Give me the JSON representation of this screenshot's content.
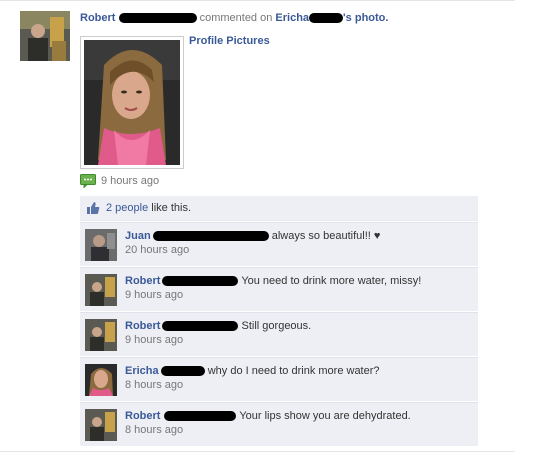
{
  "story": {
    "actor_name": "Robert",
    "action_text": "commented on",
    "photo_owner_first": "Ericha",
    "photo_suffix": "'s",
    "photo_word": "photo.",
    "album_title": "Profile Pictures",
    "timestamp": "9 hours ago"
  },
  "likes": {
    "count_text": "2 people",
    "suffix": "like this."
  },
  "comments": [
    {
      "author": "Juan",
      "text": "always so beautiful!! ♥",
      "time": "20 hours ago"
    },
    {
      "author": "Robert",
      "text": "You need to drink more water, missy!",
      "time": "9 hours ago"
    },
    {
      "author": "Robert",
      "text": "Still gorgeous.",
      "time": "9 hours ago"
    },
    {
      "author": "Ericha",
      "text": "why do I need to drink more water?",
      "time": "8 hours ago"
    },
    {
      "author": "Robert",
      "text": "Your lips show you are dehydrated.",
      "time": "8 hours ago"
    }
  ],
  "colors": {
    "link": "#3b5998",
    "ufi_bg": "#edeff4",
    "timestamp": "#777777"
  },
  "icons": {
    "comment": "comment-bubble-icon",
    "like": "thumbs-up-icon"
  }
}
